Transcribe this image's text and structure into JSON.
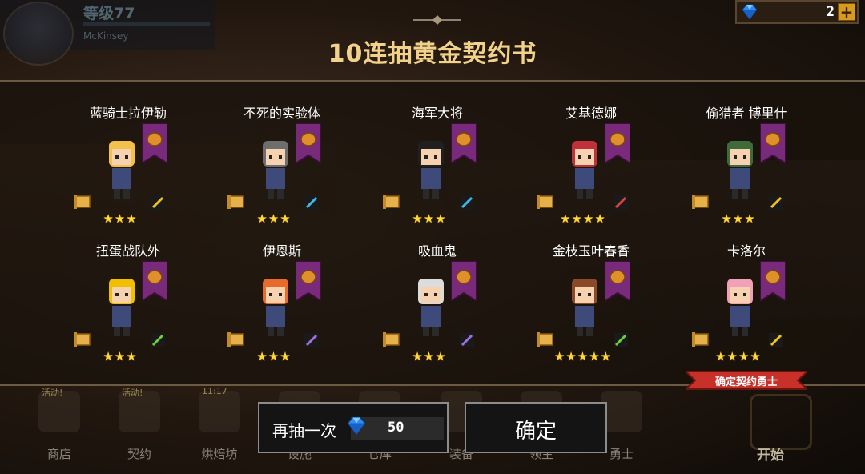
{
  "player": {
    "level": "等级77",
    "name": "McKinsey"
  },
  "currency": {
    "gems": "2",
    "plus_symbol": "+",
    "gem_icon": "diamond-icon"
  },
  "dialog": {
    "title": "10连抽黄金契约书"
  },
  "cards": [
    {
      "name": "蓝骑士拉伊勒",
      "stars": "★★★",
      "weapon_icon": "sword-icon",
      "weapon_color": "#f0c419"
    },
    {
      "name": "不死的实验体",
      "stars": "★★★",
      "weapon_icon": "axe-icon",
      "weapon_color": "#3fb8e8"
    },
    {
      "name": "海军大将",
      "stars": "★★★",
      "weapon_icon": "axe-icon",
      "weapon_color": "#3fb8e8"
    },
    {
      "name": "艾基德娜",
      "stars": "★★★★",
      "weapon_icon": "crossed-swords-icon",
      "weapon_color": "#e04040"
    },
    {
      "name": "偷猎者 博里什",
      "stars": "★★★",
      "weapon_icon": "sword-icon",
      "weapon_color": "#f0c419"
    },
    {
      "name": "扭蛋战队外",
      "stars": "★★★",
      "weapon_icon": "claw-icon",
      "weapon_color": "#6fcf3a"
    },
    {
      "name": "伊恩斯",
      "stars": "★★★",
      "weapon_icon": "staff-icon",
      "weapon_color": "#a070e0"
    },
    {
      "name": "吸血鬼",
      "stars": "★★★",
      "weapon_icon": "staff-icon",
      "weapon_color": "#a070e0"
    },
    {
      "name": "金枝玉叶春香",
      "stars": "★★★★★",
      "weapon_icon": "claw-icon",
      "weapon_color": "#6fcf3a"
    },
    {
      "name": "卡洛尔",
      "stars": "★★★★",
      "weapon_icon": "sword-icon",
      "weapon_color": "#f0c419"
    }
  ],
  "confirm_ribbon": "确定契约勇士",
  "buttons": {
    "again_label": "再抽一次",
    "again_cost": "50",
    "ok_label": "确定"
  },
  "nav": [
    {
      "label": "商店",
      "badge": "活动!"
    },
    {
      "label": "契约",
      "badge": "活动!"
    },
    {
      "label": "烘焙坊",
      "badge": "11:17"
    },
    {
      "label": "设施",
      "badge": ""
    },
    {
      "label": "仓库",
      "badge": ""
    },
    {
      "label": "装备",
      "badge": ""
    },
    {
      "label": "领主",
      "badge": ""
    },
    {
      "label": "勇士",
      "badge": ""
    }
  ],
  "start_label": "开始",
  "colors": {
    "title": "#f2d28a",
    "star": "#ffd83a",
    "banner": "#7a2a7a",
    "ribbon": "#c8302a"
  }
}
